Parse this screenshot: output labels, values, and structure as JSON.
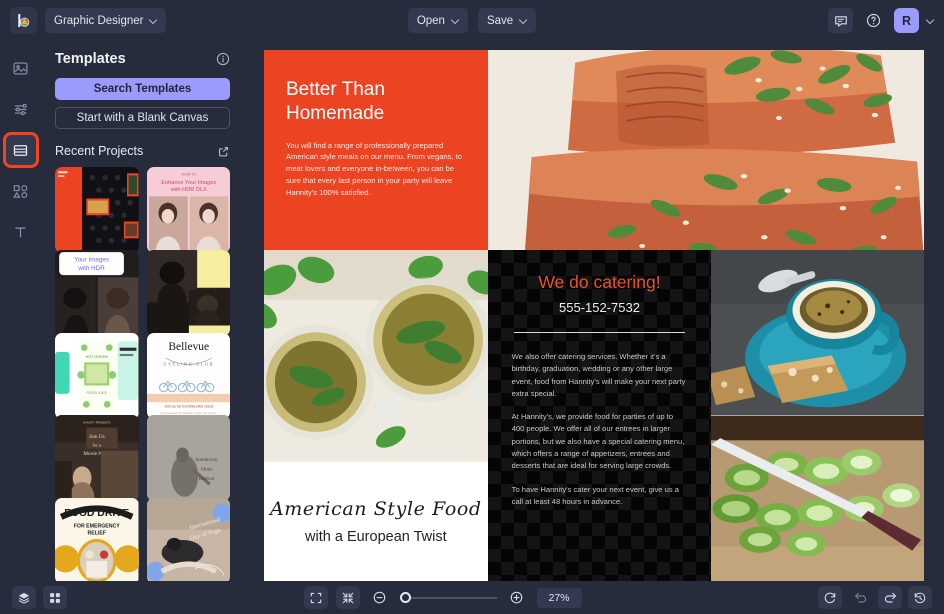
{
  "header": {
    "logo_icon": "app-logo-icon",
    "workspace": {
      "label": "Graphic Designer",
      "chevron_icon": "chevron-down-icon"
    },
    "open": {
      "label": "Open",
      "chevron_icon": "chevron-down-icon"
    },
    "save": {
      "label": "Save",
      "chevron_icon": "chevron-down-icon"
    },
    "comment_icon": "comment-icon",
    "help_icon": "help-circle-icon",
    "avatar": {
      "initial": "R",
      "chevron_icon": "chevron-down-icon",
      "color": "#9b9bfb"
    }
  },
  "rail": {
    "items": [
      {
        "name": "image",
        "icon": "image-icon",
        "selected": false
      },
      {
        "name": "adjustments",
        "icon": "sliders-icon",
        "selected": false
      },
      {
        "name": "templates",
        "icon": "templates-icon",
        "selected": true
      },
      {
        "name": "shapes",
        "icon": "shapes-icon",
        "selected": false
      },
      {
        "name": "text",
        "icon": "text-icon",
        "selected": false
      }
    ],
    "selection_color": "#f2441d"
  },
  "panel": {
    "title": "Templates",
    "info_icon": "info-circle-icon",
    "search_button": "Search Templates",
    "blank_canvas_button": "Start with a Blank Canvas",
    "recent_title": "Recent Projects",
    "external_link_icon": "external-link-icon",
    "thumbnails": [
      {
        "name": "hannitys-food-flyer",
        "caption": ""
      },
      {
        "name": "enhance-your-images-hdr-dlx",
        "caption": "Enhance Your Images with HDR DLX"
      },
      {
        "name": "your-images-with-hdr",
        "caption": "Your Images with HDR"
      },
      {
        "name": "yellow-portrait-collage",
        "caption": ""
      },
      {
        "name": "green-juice-promo",
        "caption": ""
      },
      {
        "name": "bellevue-cycling-club",
        "caption": "Bellevue"
      },
      {
        "name": "movie-night-invite",
        "caption": "Join Us for a Movie Night"
      },
      {
        "name": "hometown-blues-festival",
        "caption": "hometown blues festival"
      },
      {
        "name": "food-drive-emergency-relief",
        "caption": "FOOD DRIVE FOR EMERGENCY RELIEF"
      },
      {
        "name": "day-of-yoga",
        "caption": "Day of Yoga"
      }
    ]
  },
  "canvas": {
    "headline": "Better Than Homemade",
    "intro": "You will find a range of professionally prepared American style meals on our menu. From vegans, to meat lovers and everyone in-between, you can be sure that every last person in your party will leave Hannity's 100% satisfied.",
    "salmon_photo": "glazed-salmon-photo",
    "tea_photo": "mint-tea-photo",
    "script_line": "American Style Food",
    "script_sub": "with a European Twist",
    "catering": {
      "title": "We do catering!",
      "phone": "555-152-7532",
      "paragraph1": "We also offer catering services. Whether it's a birthday, graduation, wedding or any other large event, food from Hannity's will make your next party extra special.",
      "paragraph2": "At Hannity's, we provide food for parties of up to 400 people. We offer all of our entrees in larger portions, but we also have a special catering menu, which offers a range of appetizers, entrees and desserts that are ideal for serving large crowds.",
      "paragraph3": "To have Hannity's cater your next event, give us a call at least 48 hours in advance."
    },
    "coffee_photo": "coffee-biscotti-photo",
    "leek_photo": "sliced-leeks-photo",
    "accent_color": "#ec4422"
  },
  "footer": {
    "layers_icon": "layers-icon",
    "grid_icon": "grid-icon",
    "fit_icon": "fit-screen-icon",
    "shrink_icon": "shrink-icon",
    "zoom_out_icon": "zoom-out-icon",
    "zoom_in_icon": "zoom-in-icon",
    "zoom_level": "27%",
    "reset_icon": "reset-icon",
    "undo_icon": "undo-icon",
    "redo_icon": "redo-icon",
    "history_icon": "history-icon"
  }
}
